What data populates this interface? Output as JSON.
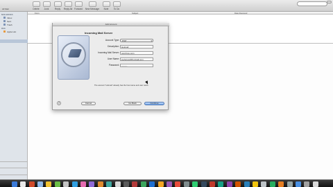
{
  "window": {
    "title": "All Mail"
  },
  "toolbar": {
    "buttons": [
      "Delete",
      "Junk",
      "Reply",
      "Reply All",
      "Forward",
      "New Message",
      "Note",
      "To Do"
    ]
  },
  "sidebar": {
    "sections": [
      {
        "header": "MAILBOXES",
        "items": [
          "Inbox",
          "Sent",
          "Trash"
        ]
      },
      {
        "header": "RSS",
        "items": [
          "Apple Hot"
        ]
      }
    ]
  },
  "message_list": {
    "columns": [
      "From",
      "Subject",
      "Date Received"
    ]
  },
  "dialog": {
    "title": "Add Account",
    "heading": "Incoming Mail Server",
    "fields": [
      {
        "label": "Account Type:",
        "value": "POP",
        "kind": "select"
      },
      {
        "label": "Description:",
        "value": "Hotmail",
        "kind": "input"
      },
      {
        "label": "Incoming Mail Server:",
        "value": "pop3.live.com",
        "kind": "input"
      },
      {
        "label": "User Name:",
        "value": "joeforrest@hotmail.com",
        "kind": "input"
      },
      {
        "label": "Password:",
        "value": "••••••••",
        "kind": "input"
      }
    ],
    "note": "The account \"Hotmail\" already has the host name and user name.",
    "buttons": {
      "help": "?",
      "cancel": "Cancel",
      "back": "Go Back",
      "continue": "Continue"
    }
  },
  "dock": {
    "icon_colors": [
      "#3b7ad8",
      "#e9e9e9",
      "#d04a2b",
      "#8fb8e8",
      "#f2c230",
      "#6bbd45",
      "#c3c3c3",
      "#2f9ee0",
      "#e56bb0",
      "#8f6ad8",
      "#e08b2f",
      "#40a8a0",
      "#d8d8d8",
      "#5b5b5b",
      "#b33a3a",
      "#3ba55c",
      "#1f6fd1",
      "#f5a623",
      "#9b59b6",
      "#e74c3c",
      "#7f8c8d",
      "#2ecc71",
      "#34495e",
      "#c0392b",
      "#16a085",
      "#8e44ad",
      "#d35400",
      "#2980b9",
      "#f1c40f",
      "#bdc3c7",
      "#27ae60",
      "#e67e22",
      "#95a5a6",
      "#4a90e2",
      "#a0a0a0",
      "#d9d9d9"
    ]
  }
}
